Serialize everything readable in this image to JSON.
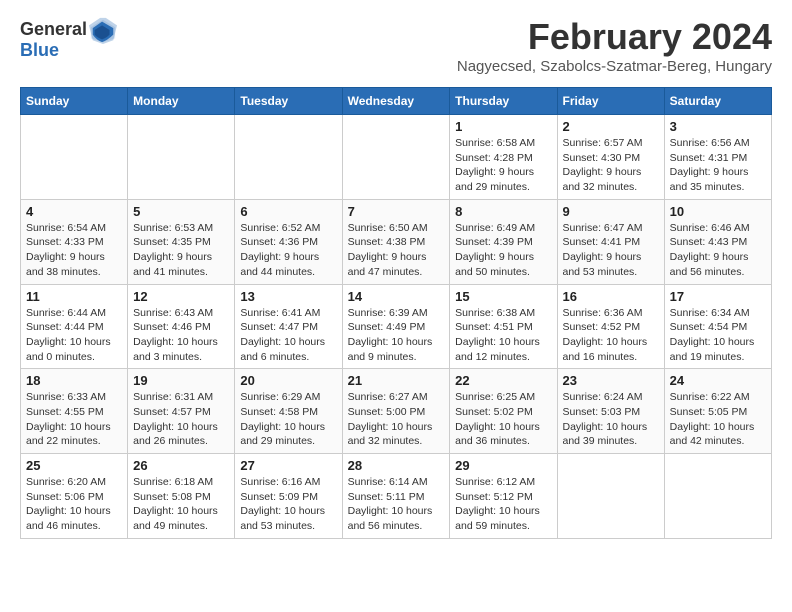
{
  "header": {
    "logo_text_general": "General",
    "logo_text_blue": "Blue",
    "month_title": "February 2024",
    "location": "Nagyecsed, Szabolcs-Szatmar-Bereg, Hungary"
  },
  "weekdays": [
    "Sunday",
    "Monday",
    "Tuesday",
    "Wednesday",
    "Thursday",
    "Friday",
    "Saturday"
  ],
  "weeks": [
    [
      {
        "day": "",
        "sunrise": "",
        "sunset": "",
        "daylight": ""
      },
      {
        "day": "",
        "sunrise": "",
        "sunset": "",
        "daylight": ""
      },
      {
        "day": "",
        "sunrise": "",
        "sunset": "",
        "daylight": ""
      },
      {
        "day": "",
        "sunrise": "",
        "sunset": "",
        "daylight": ""
      },
      {
        "day": "1",
        "sunrise": "Sunrise: 6:58 AM",
        "sunset": "Sunset: 4:28 PM",
        "daylight": "Daylight: 9 hours and 29 minutes."
      },
      {
        "day": "2",
        "sunrise": "Sunrise: 6:57 AM",
        "sunset": "Sunset: 4:30 PM",
        "daylight": "Daylight: 9 hours and 32 minutes."
      },
      {
        "day": "3",
        "sunrise": "Sunrise: 6:56 AM",
        "sunset": "Sunset: 4:31 PM",
        "daylight": "Daylight: 9 hours and 35 minutes."
      }
    ],
    [
      {
        "day": "4",
        "sunrise": "Sunrise: 6:54 AM",
        "sunset": "Sunset: 4:33 PM",
        "daylight": "Daylight: 9 hours and 38 minutes."
      },
      {
        "day": "5",
        "sunrise": "Sunrise: 6:53 AM",
        "sunset": "Sunset: 4:35 PM",
        "daylight": "Daylight: 9 hours and 41 minutes."
      },
      {
        "day": "6",
        "sunrise": "Sunrise: 6:52 AM",
        "sunset": "Sunset: 4:36 PM",
        "daylight": "Daylight: 9 hours and 44 minutes."
      },
      {
        "day": "7",
        "sunrise": "Sunrise: 6:50 AM",
        "sunset": "Sunset: 4:38 PM",
        "daylight": "Daylight: 9 hours and 47 minutes."
      },
      {
        "day": "8",
        "sunrise": "Sunrise: 6:49 AM",
        "sunset": "Sunset: 4:39 PM",
        "daylight": "Daylight: 9 hours and 50 minutes."
      },
      {
        "day": "9",
        "sunrise": "Sunrise: 6:47 AM",
        "sunset": "Sunset: 4:41 PM",
        "daylight": "Daylight: 9 hours and 53 minutes."
      },
      {
        "day": "10",
        "sunrise": "Sunrise: 6:46 AM",
        "sunset": "Sunset: 4:43 PM",
        "daylight": "Daylight: 9 hours and 56 minutes."
      }
    ],
    [
      {
        "day": "11",
        "sunrise": "Sunrise: 6:44 AM",
        "sunset": "Sunset: 4:44 PM",
        "daylight": "Daylight: 10 hours and 0 minutes."
      },
      {
        "day": "12",
        "sunrise": "Sunrise: 6:43 AM",
        "sunset": "Sunset: 4:46 PM",
        "daylight": "Daylight: 10 hours and 3 minutes."
      },
      {
        "day": "13",
        "sunrise": "Sunrise: 6:41 AM",
        "sunset": "Sunset: 4:47 PM",
        "daylight": "Daylight: 10 hours and 6 minutes."
      },
      {
        "day": "14",
        "sunrise": "Sunrise: 6:39 AM",
        "sunset": "Sunset: 4:49 PM",
        "daylight": "Daylight: 10 hours and 9 minutes."
      },
      {
        "day": "15",
        "sunrise": "Sunrise: 6:38 AM",
        "sunset": "Sunset: 4:51 PM",
        "daylight": "Daylight: 10 hours and 12 minutes."
      },
      {
        "day": "16",
        "sunrise": "Sunrise: 6:36 AM",
        "sunset": "Sunset: 4:52 PM",
        "daylight": "Daylight: 10 hours and 16 minutes."
      },
      {
        "day": "17",
        "sunrise": "Sunrise: 6:34 AM",
        "sunset": "Sunset: 4:54 PM",
        "daylight": "Daylight: 10 hours and 19 minutes."
      }
    ],
    [
      {
        "day": "18",
        "sunrise": "Sunrise: 6:33 AM",
        "sunset": "Sunset: 4:55 PM",
        "daylight": "Daylight: 10 hours and 22 minutes."
      },
      {
        "day": "19",
        "sunrise": "Sunrise: 6:31 AM",
        "sunset": "Sunset: 4:57 PM",
        "daylight": "Daylight: 10 hours and 26 minutes."
      },
      {
        "day": "20",
        "sunrise": "Sunrise: 6:29 AM",
        "sunset": "Sunset: 4:58 PM",
        "daylight": "Daylight: 10 hours and 29 minutes."
      },
      {
        "day": "21",
        "sunrise": "Sunrise: 6:27 AM",
        "sunset": "Sunset: 5:00 PM",
        "daylight": "Daylight: 10 hours and 32 minutes."
      },
      {
        "day": "22",
        "sunrise": "Sunrise: 6:25 AM",
        "sunset": "Sunset: 5:02 PM",
        "daylight": "Daylight: 10 hours and 36 minutes."
      },
      {
        "day": "23",
        "sunrise": "Sunrise: 6:24 AM",
        "sunset": "Sunset: 5:03 PM",
        "daylight": "Daylight: 10 hours and 39 minutes."
      },
      {
        "day": "24",
        "sunrise": "Sunrise: 6:22 AM",
        "sunset": "Sunset: 5:05 PM",
        "daylight": "Daylight: 10 hours and 42 minutes."
      }
    ],
    [
      {
        "day": "25",
        "sunrise": "Sunrise: 6:20 AM",
        "sunset": "Sunset: 5:06 PM",
        "daylight": "Daylight: 10 hours and 46 minutes."
      },
      {
        "day": "26",
        "sunrise": "Sunrise: 6:18 AM",
        "sunset": "Sunset: 5:08 PM",
        "daylight": "Daylight: 10 hours and 49 minutes."
      },
      {
        "day": "27",
        "sunrise": "Sunrise: 6:16 AM",
        "sunset": "Sunset: 5:09 PM",
        "daylight": "Daylight: 10 hours and 53 minutes."
      },
      {
        "day": "28",
        "sunrise": "Sunrise: 6:14 AM",
        "sunset": "Sunset: 5:11 PM",
        "daylight": "Daylight: 10 hours and 56 minutes."
      },
      {
        "day": "29",
        "sunrise": "Sunrise: 6:12 AM",
        "sunset": "Sunset: 5:12 PM",
        "daylight": "Daylight: 10 hours and 59 minutes."
      },
      {
        "day": "",
        "sunrise": "",
        "sunset": "",
        "daylight": ""
      },
      {
        "day": "",
        "sunrise": "",
        "sunset": "",
        "daylight": ""
      }
    ]
  ]
}
